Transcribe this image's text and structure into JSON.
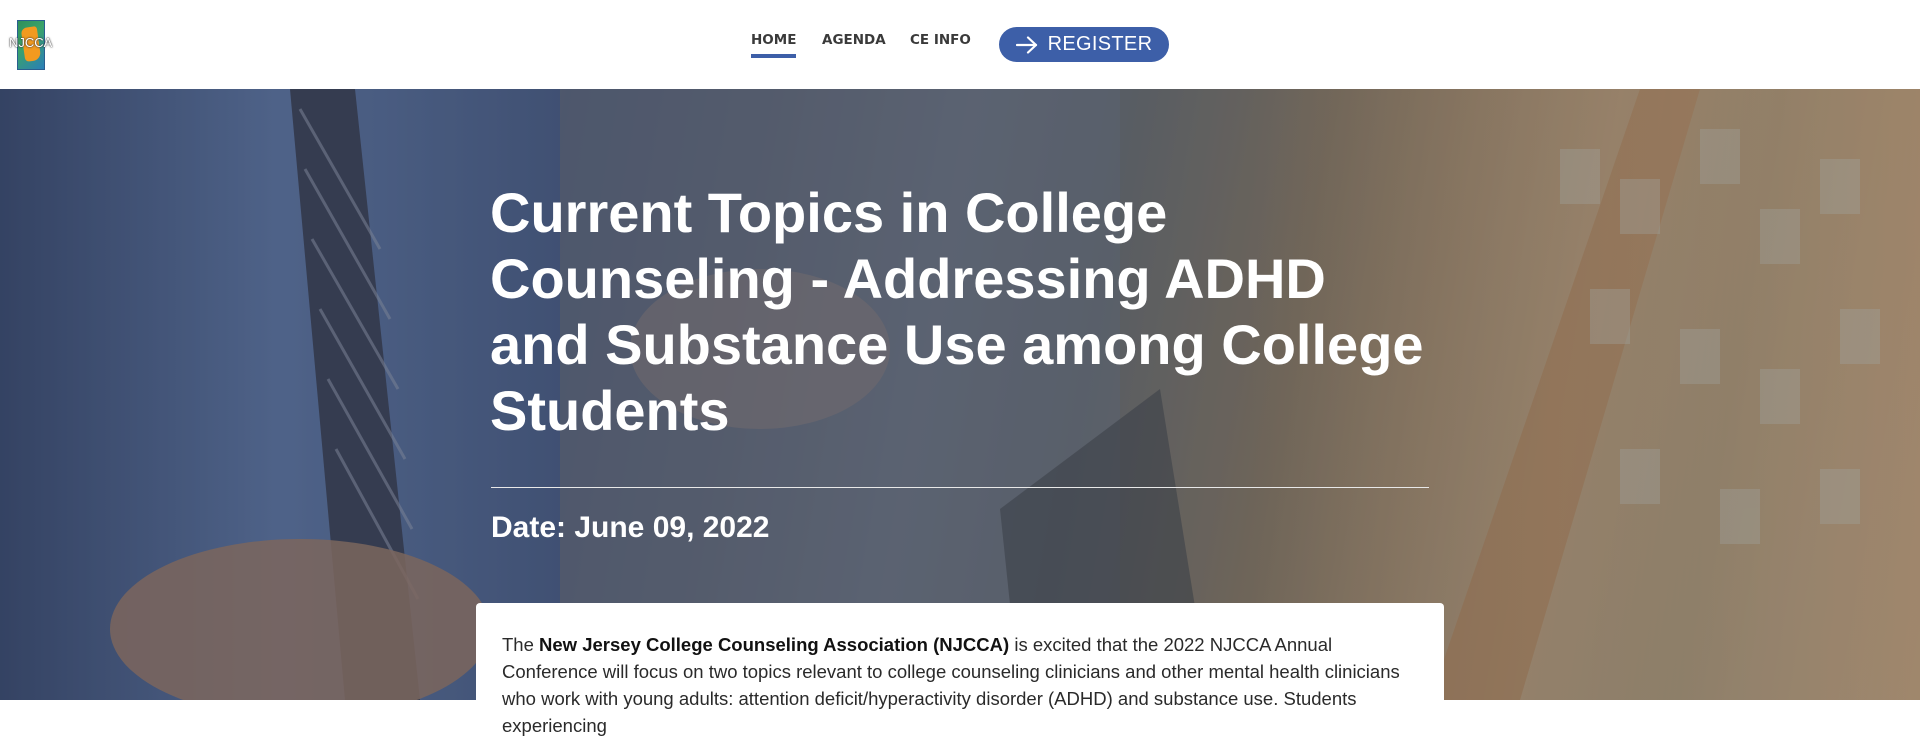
{
  "header": {
    "logo_text": "NJCCA",
    "nav": [
      {
        "label": "HOME",
        "active": true
      },
      {
        "label": "AGENDA",
        "active": false
      },
      {
        "label": "CE INFO",
        "active": false
      }
    ],
    "register_label": "REGISTER",
    "accent_color": "#3d5fa8"
  },
  "hero": {
    "title": "Current Topics in College Counseling - Addressing ADHD and Substance Use among College Students",
    "date": "Date: June 09, 2022"
  },
  "intro": {
    "lead": "The",
    "org_name": "New Jersey College Counseling Association (NJCCA)",
    "body": "is excited that the 2022 NJCCA Annual Conference will focus on two topics relevant to college counseling clinicians and other mental health clinicians who work with young adults: attention deficit/hyperactivity disorder (ADHD) and substance use.  Students experiencing"
  }
}
